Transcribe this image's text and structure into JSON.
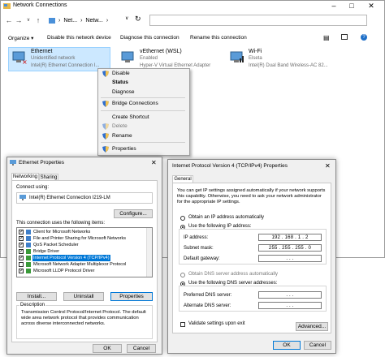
{
  "window": {
    "title": "Network Connections"
  },
  "breadcrumb": [
    "Net...",
    "Netw..."
  ],
  "toolbar": {
    "organize": "Organize",
    "disable": "Disable this network device",
    "diagnose": "Diagnose this connection",
    "rename": "Rename this connection"
  },
  "connections": [
    {
      "name": "Ethernet",
      "status": "Unidentified network",
      "adapter": "Intel(R) Ethernet Connection I..."
    },
    {
      "name": "vEthernet (WSL)",
      "status": "Enabled",
      "adapter": "Hyper-V Virtual Ethernet Adapter"
    },
    {
      "name": "Wi-Fi",
      "status": "Elseta",
      "adapter": "Intel(R) Dual Band Wireless-AC 82..."
    }
  ],
  "context_menu": {
    "disable": "Disable",
    "status": "Status",
    "diagnose": "Diagnose",
    "bridge": "Bridge Connections",
    "shortcut": "Create Shortcut",
    "delete": "Delete",
    "rename": "Rename",
    "properties": "Properties"
  },
  "eth_props": {
    "title": "Ethernet Properties",
    "tabs": [
      "Networking",
      "Sharing"
    ],
    "connect_using": "Connect using:",
    "adapter": "Intel(R) Ethernet Connection I219-LM",
    "configure": "Configure...",
    "items_label": "This connection uses the following items:",
    "items": [
      "Client for Microsoft Networks",
      "File and Printer Sharing for Microsoft Networks",
      "QoS Packet Scheduler",
      "Bridge Driver",
      "Internet Protocol Version 4 (TCP/IPv4)",
      "Microsoft Network Adapter Multiplexor Protocol",
      "Microsoft LLDP Protocol Driver"
    ],
    "install": "Install...",
    "uninstall": "Uninstall",
    "properties": "Properties",
    "description_label": "Description",
    "description": "Transmission Control Protocol/Internet Protocol. The default wide area network protocol that provides communication across diverse interconnected networks.",
    "ok": "OK",
    "cancel": "Cancel"
  },
  "ipv4": {
    "title": "Internet Protocol Version 4 (TCP/IPv4) Properties",
    "tab": "General",
    "intro": "You can get IP settings assigned automatically if your network supports this capability. Otherwise, you need to ask your network administrator for the appropriate IP settings.",
    "auto_ip": "Obtain an IP address automatically",
    "use_ip": "Use the following IP address:",
    "ip_label": "IP address:",
    "ip_value": "192 . 168 .  1  .  2",
    "mask_label": "Subnet mask:",
    "mask_value": "255 . 255 . 255 .  0",
    "gateway_label": "Default gateway:",
    "gateway_value": ".    .    .",
    "auto_dns": "Obtain DNS server address automatically",
    "use_dns": "Use the following DNS server addresses:",
    "pref_dns_label": "Preferred DNS server:",
    "pref_dns_value": ".    .    .",
    "alt_dns_label": "Alternate DNS server:",
    "alt_dns_value": ".    .    .",
    "validate": "Validate settings upon exit",
    "advanced": "Advanced...",
    "ok": "OK",
    "cancel": "Cancel"
  },
  "colors": {
    "accent": "#0078d7",
    "selection": "#cce8ff"
  }
}
